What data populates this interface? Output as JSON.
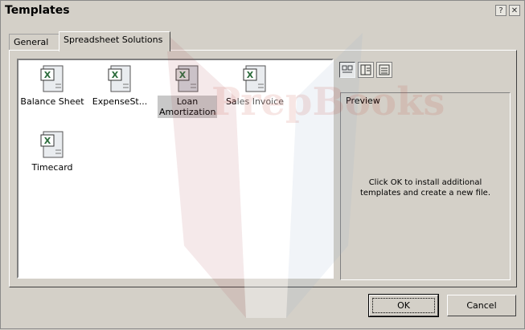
{
  "window": {
    "title": "Templates",
    "help_button": "?",
    "close_button": "✕"
  },
  "tabs": [
    {
      "label": "General",
      "active": false
    },
    {
      "label": "Spreadsheet Solutions",
      "active": true
    }
  ],
  "templates": [
    {
      "label": "Balance Sheet",
      "icon": "excel-template-icon",
      "selected": false
    },
    {
      "label": "ExpenseSt...",
      "icon": "excel-template-icon",
      "selected": false
    },
    {
      "label": "Loan Amortization",
      "icon": "excel-template-icon",
      "selected": true
    },
    {
      "label": "Sales Invoice",
      "icon": "excel-template-icon",
      "selected": false
    },
    {
      "label": "Timecard",
      "icon": "excel-template-icon",
      "selected": false
    }
  ],
  "view_buttons": [
    {
      "name": "large-icons-view",
      "active": true
    },
    {
      "name": "list-view",
      "active": false
    },
    {
      "name": "details-view",
      "active": false
    }
  ],
  "preview": {
    "title": "Preview",
    "message": "Click OK to install additional templates and create a new file."
  },
  "buttons": {
    "ok": "OK",
    "cancel": "Cancel"
  },
  "watermark": {
    "text": "PrepBooks",
    "color": "#c0392b"
  }
}
